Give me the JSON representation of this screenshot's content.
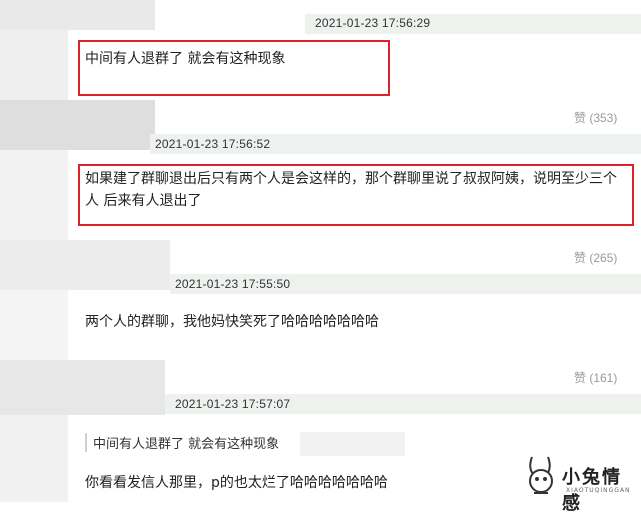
{
  "comments": [
    {
      "timestamp": "2021-01-23 17:56:29",
      "text": "中间有人退群了 就会有这种现象"
    },
    {
      "likes": "赞 (353)",
      "timestamp": "2021-01-23 17:56:52",
      "text": "如果建了群聊退出后只有两个人是会这样的，那个群聊里说了叔叔阿姨，说明至少三个人 后来有人退出了"
    },
    {
      "likes": "赞 (265)",
      "timestamp": "2021-01-23 17:55:50",
      "text": "两个人的群聊，我他妈快笑死了哈哈哈哈哈哈哈"
    },
    {
      "likes": "赞 (161)",
      "timestamp": "2021-01-23 17:57:07",
      "quote": "中间有人退群了 就会有这种现象",
      "text": "你看看发信人那里，p的也太烂了哈哈哈哈哈哈哈"
    }
  ],
  "watermark": {
    "title": "小兔情感",
    "subtitle": "XIAOTUQINGGAN",
    "icon": "rabbit-logo-icon"
  },
  "colors": {
    "highlight_border": "#d9232d",
    "timestamp_bar": "#edf2ee",
    "like_text": "#9a9a9a"
  }
}
